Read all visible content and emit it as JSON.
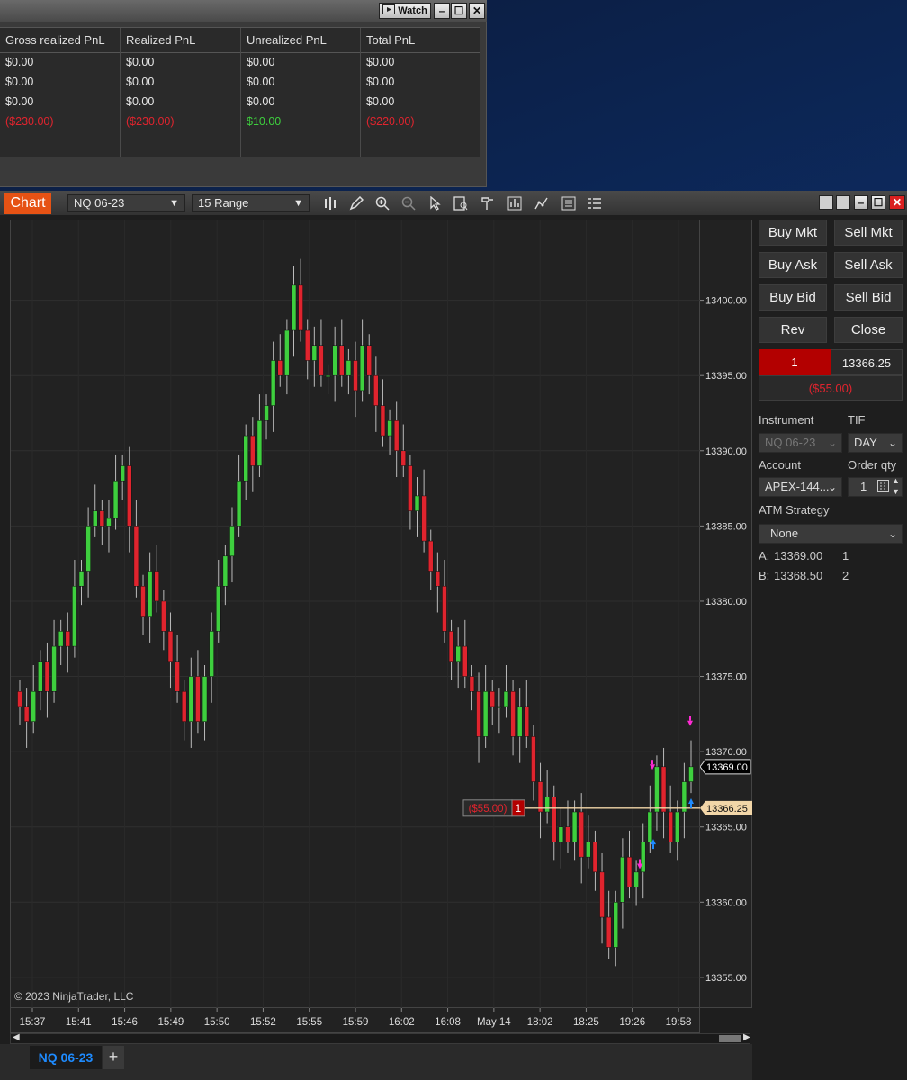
{
  "pnl_window": {
    "watch_label": "Watch",
    "columns": [
      "Gross realized PnL",
      "Realized PnL",
      "Unrealized PnL",
      "Total PnL"
    ],
    "rows": [
      [
        "$0.00",
        "$0.00",
        "$0.00",
        "$0.00"
      ],
      [
        "$0.00",
        "$0.00",
        "$0.00",
        "$0.00"
      ],
      [
        "$0.00",
        "$0.00",
        "$0.00",
        "$0.00"
      ],
      [
        "($230.00)",
        "($230.00)",
        "$10.00",
        "($220.00)"
      ]
    ]
  },
  "chart_window": {
    "title": "Chart",
    "instrument": "NQ 06-23",
    "bar_type": "15 Range",
    "tab_label": "NQ 06-23",
    "add_tab": "+",
    "copyright": "© 2023 NinjaTrader, LLC",
    "position_label": "($55.00)",
    "position_qty": "1",
    "current_price_tag": "13366.25",
    "ask_price_tag": "13369.00"
  },
  "chart_data": {
    "type": "candlestick",
    "y_ticks": [
      13355,
      13360,
      13365,
      13370,
      13375,
      13380,
      13385,
      13390,
      13395,
      13400
    ],
    "y_tick_labels": [
      "13355.00",
      "13360.00",
      "13365.00",
      "13370.00",
      "13375.00",
      "13380.00",
      "13385.00",
      "13390.00",
      "13395.00",
      "13400.00"
    ],
    "x_tick_labels": [
      "15:37",
      "15:41",
      "15:46",
      "15:49",
      "15:50",
      "15:52",
      "15:55",
      "15:59",
      "16:02",
      "16:08",
      "May 14",
      "18:02",
      "18:25",
      "19:26",
      "19:58"
    ],
    "ylim": [
      13352.9,
      13405.3
    ],
    "closes": [
      13373,
      13372,
      13374,
      13376,
      13374,
      13377,
      13378,
      13377,
      13381,
      13382,
      13385,
      13386,
      13385,
      13385.5,
      13388,
      13389,
      13385,
      13381,
      13379,
      13382,
      13380,
      13378,
      13376,
      13374,
      13372,
      13375,
      13372,
      13375,
      13378,
      13381,
      13383,
      13385,
      13388,
      13391,
      13389,
      13392,
      13393,
      13396,
      13395,
      13398,
      13401,
      13398,
      13396,
      13397,
      13395,
      13395,
      13397,
      13395,
      13396,
      13394,
      13397,
      13395,
      13393,
      13391,
      13392,
      13390,
      13389,
      13386,
      13387,
      13384,
      13382,
      13381,
      13378,
      13376,
      13377,
      13375,
      13374,
      13371,
      13374,
      13373,
      13373,
      13374,
      13371,
      13373,
      13371,
      13368,
      13366,
      13367,
      13364,
      13365,
      13364,
      13366,
      13363,
      13364,
      13362,
      13359,
      13357,
      13360,
      13363,
      13361,
      13362,
      13364,
      13366,
      13369,
      13366,
      13364,
      13366,
      13368,
      13369
    ],
    "current_price": 13366.25,
    "ask": 13369.0,
    "bid": 13368.5
  },
  "order_panel": {
    "buttons": [
      "Buy Mkt",
      "Sell Mkt",
      "Buy Ask",
      "Sell Ask",
      "Buy Bid",
      "Sell Bid",
      "Rev",
      "Close"
    ],
    "position_qty": "1",
    "position_price": "13366.25",
    "position_pnl": "($55.00)",
    "instrument_label": "Instrument",
    "instrument_value": "NQ 06-23",
    "tif_label": "TIF",
    "tif_value": "DAY",
    "account_label": "Account",
    "account_value": "APEX-144...",
    "order_qty_label": "Order qty",
    "order_qty_value": "1",
    "atm_label": "ATM Strategy",
    "atm_value": "None",
    "ask_label": "A:",
    "ask_price": "13369.00",
    "ask_size": "1",
    "bid_label": "B:",
    "bid_price": "13368.50",
    "bid_size": "2"
  },
  "colors": {
    "up_candle": "#3ecf3e",
    "down_candle": "#e0242e",
    "chart_tab": "#e65214",
    "price_line": "#f2d6a8"
  }
}
